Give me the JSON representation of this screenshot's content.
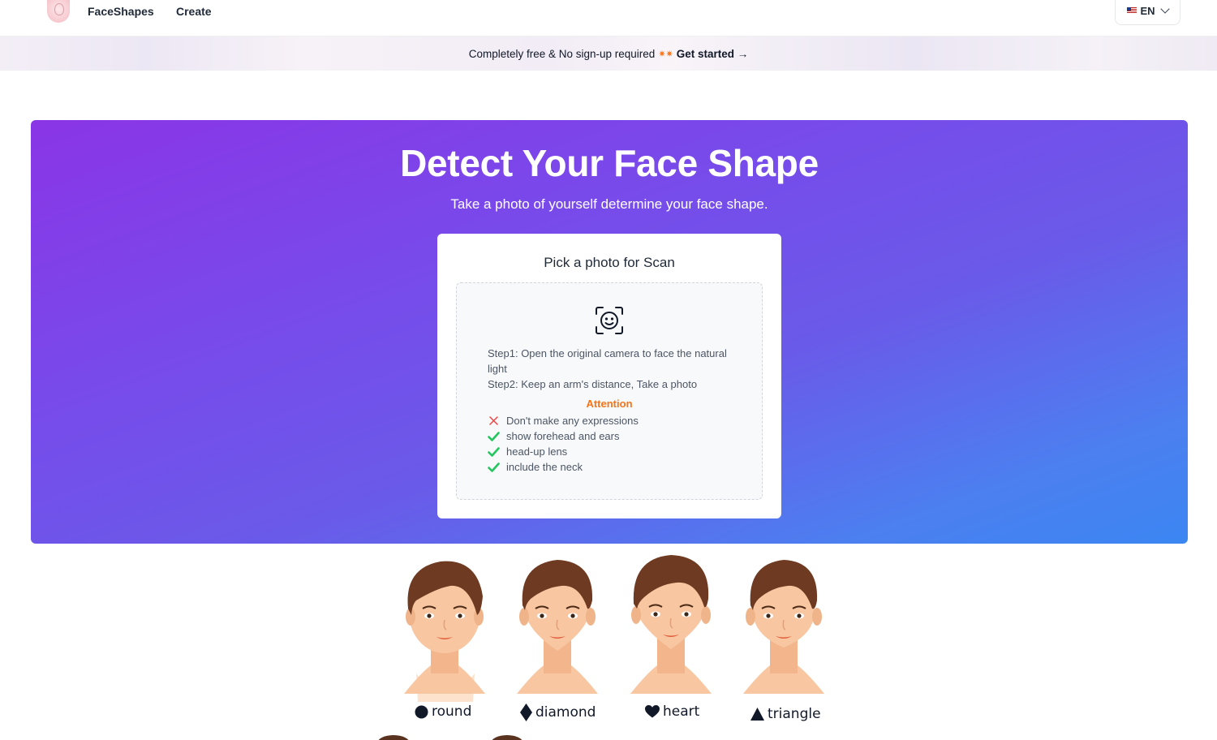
{
  "header": {
    "brand": "FaceShapes",
    "nav": {
      "create": "Create"
    },
    "language": {
      "label": "EN"
    }
  },
  "banner": {
    "text": "Completely free & No sign-up required",
    "sparkles": "✷✷",
    "cta": "Get started →"
  },
  "hero": {
    "title": "Detect Your Face Shape",
    "subtitle": "Take a photo of yourself determine your face shape.",
    "card": {
      "title": "Pick a photo for Scan",
      "step1": "Step1: Open the original camera to face the natural light",
      "step2": "Step2: Keep an arm's distance, Take a photo",
      "attention": "Attention",
      "rules": [
        {
          "text": "Don't make any expressions",
          "icon": "x-icon",
          "color": "#ef4444"
        },
        {
          "text": "show forehead and ears",
          "icon": "check-icon",
          "color": "#22c55e"
        },
        {
          "text": "head-up lens",
          "icon": "check-icon",
          "color": "#22c55e"
        },
        {
          "text": "include the neck",
          "icon": "check-icon",
          "color": "#22c55e"
        }
      ]
    },
    "colors": {
      "gradient_start": "#8a35e6",
      "gradient_end": "#3b86f2"
    }
  },
  "face_shapes": [
    {
      "label": "round",
      "symbol": "circle"
    },
    {
      "label": "diamond",
      "symbol": "diamond"
    },
    {
      "label": "heart",
      "symbol": "heart"
    },
    {
      "label": "triangle",
      "symbol": "triangle"
    }
  ]
}
